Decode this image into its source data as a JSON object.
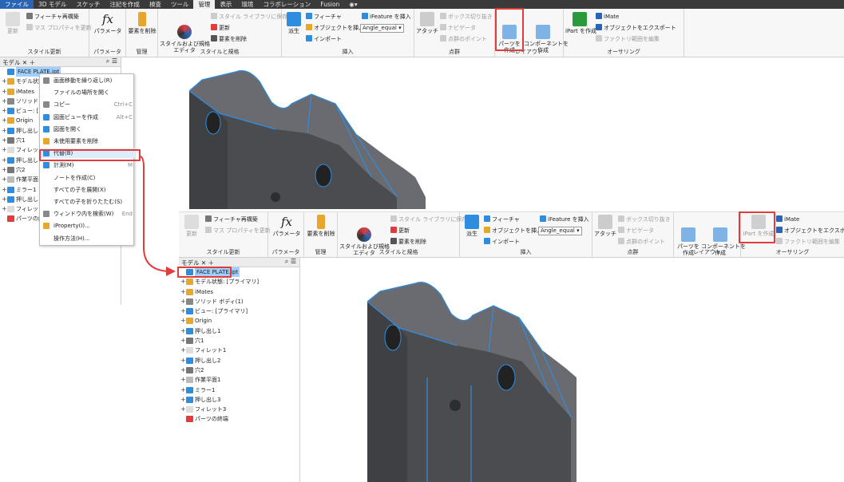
{
  "top": {
    "tabs": [
      "ファイル",
      "3D モデル",
      "スケッチ",
      "注記を作成",
      "検査",
      "ツール",
      "管理",
      "表示",
      "環境",
      "コラボレーション",
      "Fusion"
    ],
    "active_tab": "管理",
    "groups": {
      "update": {
        "label": "スタイル更新",
        "items": [
          "フィーチャ再構築",
          "マス プロパティを更新",
          "更新"
        ]
      },
      "params": {
        "label": "パラメータ",
        "btn": "パラメータ"
      },
      "manage": {
        "label": "管理",
        "btn": "要素を削除"
      },
      "styles": {
        "label": "スタイルと規格",
        "btn": "スタイルおよび規格\nエディタ",
        "items": [
          "スタイル ライブラリに保存",
          "更新",
          "要素を削除"
        ]
      },
      "insert": {
        "label": "挿入",
        "btn": "派生",
        "items": [
          "フィーチャ",
          "オブジェクトを挿入",
          "インポート",
          "iFeature を挿入"
        ],
        "drop": "Angle_equal"
      },
      "points": {
        "label": "点群",
        "btn": "アタッチ",
        "items": [
          "ボックス切り抜き",
          "ナビゲータ",
          "点群のポイント"
        ]
      },
      "layout": {
        "label": "レイアウト",
        "btn1": "パーツを\n作成",
        "btn2": "コンポーネントを\n作成"
      },
      "author": {
        "label": "オーサリング",
        "btn": "iPart を作成",
        "items": [
          "iMate",
          "オブジェクトをエクスポート",
          "ファクトリ範囲を編集"
        ]
      }
    },
    "panel_tab": "モデル",
    "tree": [
      "FACE PLATE.ipt",
      "モデル状態",
      "iMates",
      "ソリッド ボ",
      "ビュー: [プ",
      "Origin",
      "押し出し",
      "穴1",
      "フィレット",
      "押し出し",
      "穴2",
      "作業平面",
      "ミラー1",
      "押し出し",
      "フィレット",
      "パーツの終端"
    ],
    "menu": [
      {
        "label": "画面移動を繰り返し(R)",
        "sc": ""
      },
      {
        "label": "ファイルの場所を開く",
        "sc": ""
      },
      {
        "label": "コピー",
        "sc": "Ctrl+C"
      },
      {
        "label": "図面ビューを作成",
        "sc": "Alt+C"
      },
      {
        "label": "図面を開く",
        "sc": ""
      },
      {
        "label": "未使用要素を削除",
        "sc": ""
      },
      {
        "label": "代替(B)",
        "sc": ""
      },
      {
        "label": "計測(M)",
        "sc": "M"
      },
      {
        "label": "ノートを作成(C)",
        "sc": ""
      },
      {
        "label": "すべての子を展開(X)",
        "sc": ""
      },
      {
        "label": "すべての子を折りたたむ(S)",
        "sc": ""
      },
      {
        "label": "ウィンドウ内を検索(W)",
        "sc": "End"
      },
      {
        "label": "iProperty(I)...",
        "sc": ""
      },
      {
        "label": "操作方法(H)...",
        "sc": ""
      }
    ]
  },
  "bottom": {
    "panel_tab": "モデル",
    "tree": [
      "FACE PLATE.ipt",
      "モデル状態: [プライマリ]",
      "iMates",
      "ソリッド ボディ(1)",
      "ビュー: [プライマリ]",
      "Origin",
      "押し出し1",
      "穴1",
      "フィレット1",
      "押し出し2",
      "穴2",
      "作業平面1",
      "ミラー1",
      "押し出し3",
      "フィレット3",
      "パーツの終端"
    ]
  },
  "colors": {
    "ribbon_bg": "#f7f7f7",
    "highlight": "#e23b3b",
    "model": "#4b4c50",
    "edge": "#2f8de0",
    "selection": "#9fd0ff"
  }
}
